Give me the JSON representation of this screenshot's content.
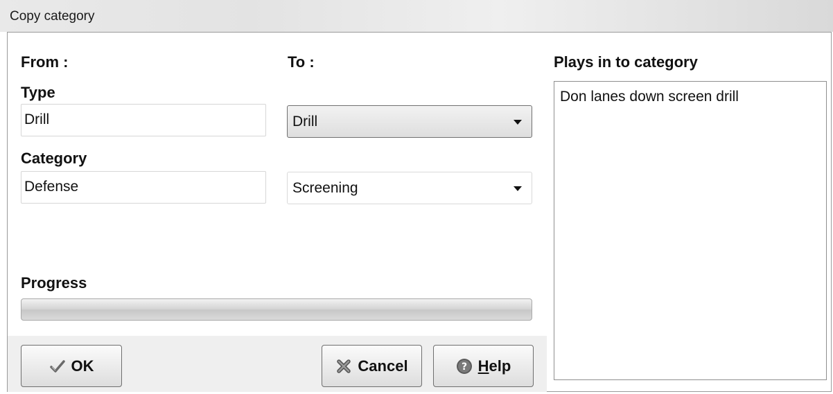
{
  "window": {
    "title": "Copy category"
  },
  "from": {
    "heading": "From :",
    "type_label": "Type",
    "type_value": "Drill",
    "category_label": "Category",
    "category_value": "Defense"
  },
  "to": {
    "heading": "To :",
    "type_selected": "Drill",
    "category_selected": "Screening"
  },
  "plays": {
    "heading": "Plays in to category",
    "items": [
      "Don lanes down screen drill"
    ]
  },
  "progress": {
    "label": "Progress",
    "value": 0
  },
  "buttons": {
    "ok": "OK",
    "cancel": "Cancel",
    "help_mnemonic": "H",
    "help_rest": "elp"
  },
  "icons": {
    "ok": "checkmark-icon",
    "cancel": "cancel-x-icon",
    "help": "help-question-icon"
  }
}
